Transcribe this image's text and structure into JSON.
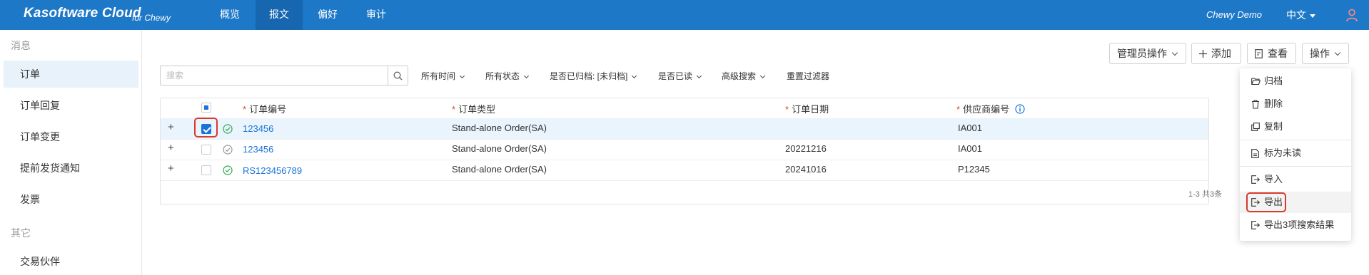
{
  "topbar": {
    "brand": "Kasoftware Cloud",
    "brand_sub": "for Chewy",
    "tabs": [
      "概览",
      "报文",
      "偏好",
      "审计"
    ],
    "active_tab": "报文",
    "user": "Chewy Demo",
    "language": "中文",
    "bar_color": "#1e78c8"
  },
  "sidebar": {
    "group_messages": "消息",
    "items": [
      "订单",
      "订单回复",
      "订单变更",
      "提前发货通知",
      "发票"
    ],
    "active_item": "订单",
    "group_other": "其它",
    "other_items": [
      "交易伙伴"
    ]
  },
  "toolbar": {
    "admin_ops": "管理员操作",
    "add": "添加",
    "view": "查看",
    "actions": "操作"
  },
  "search": {
    "placeholder": "搜索",
    "icon": "search-icon"
  },
  "filters": [
    "所有时间",
    "所有状态",
    "是否已归档: [未归档]",
    "是否已读",
    "高级搜索"
  ],
  "reset_filters": "重置过滤器",
  "table": {
    "columns": [
      "订单编号",
      "订单类型",
      "订单日期",
      "供应商编号"
    ],
    "rows": [
      {
        "order_no": "123456",
        "type": "Stand-alone Order(SA)",
        "date": "",
        "supplier": "IA001",
        "checked": true,
        "status": "success"
      },
      {
        "order_no": "123456",
        "type": "Stand-alone Order(SA)",
        "date": "20221216",
        "supplier": "IA001",
        "checked": false,
        "status": "neutral"
      },
      {
        "order_no": "RS123456789",
        "type": "Stand-alone Order(SA)",
        "date": "20241016",
        "supplier": "P12345",
        "checked": false,
        "status": "success"
      }
    ],
    "pager": "1-3 共3条"
  },
  "actions_menu": {
    "items": [
      "归档",
      "删除",
      "复制",
      "标为未读",
      "导入",
      "导出",
      "导出3项搜索结果"
    ],
    "highlighted": "导出"
  },
  "colors": {
    "accent": "#1a73d9",
    "highlight_border": "#d93a2e",
    "success": "#2fa84f"
  }
}
